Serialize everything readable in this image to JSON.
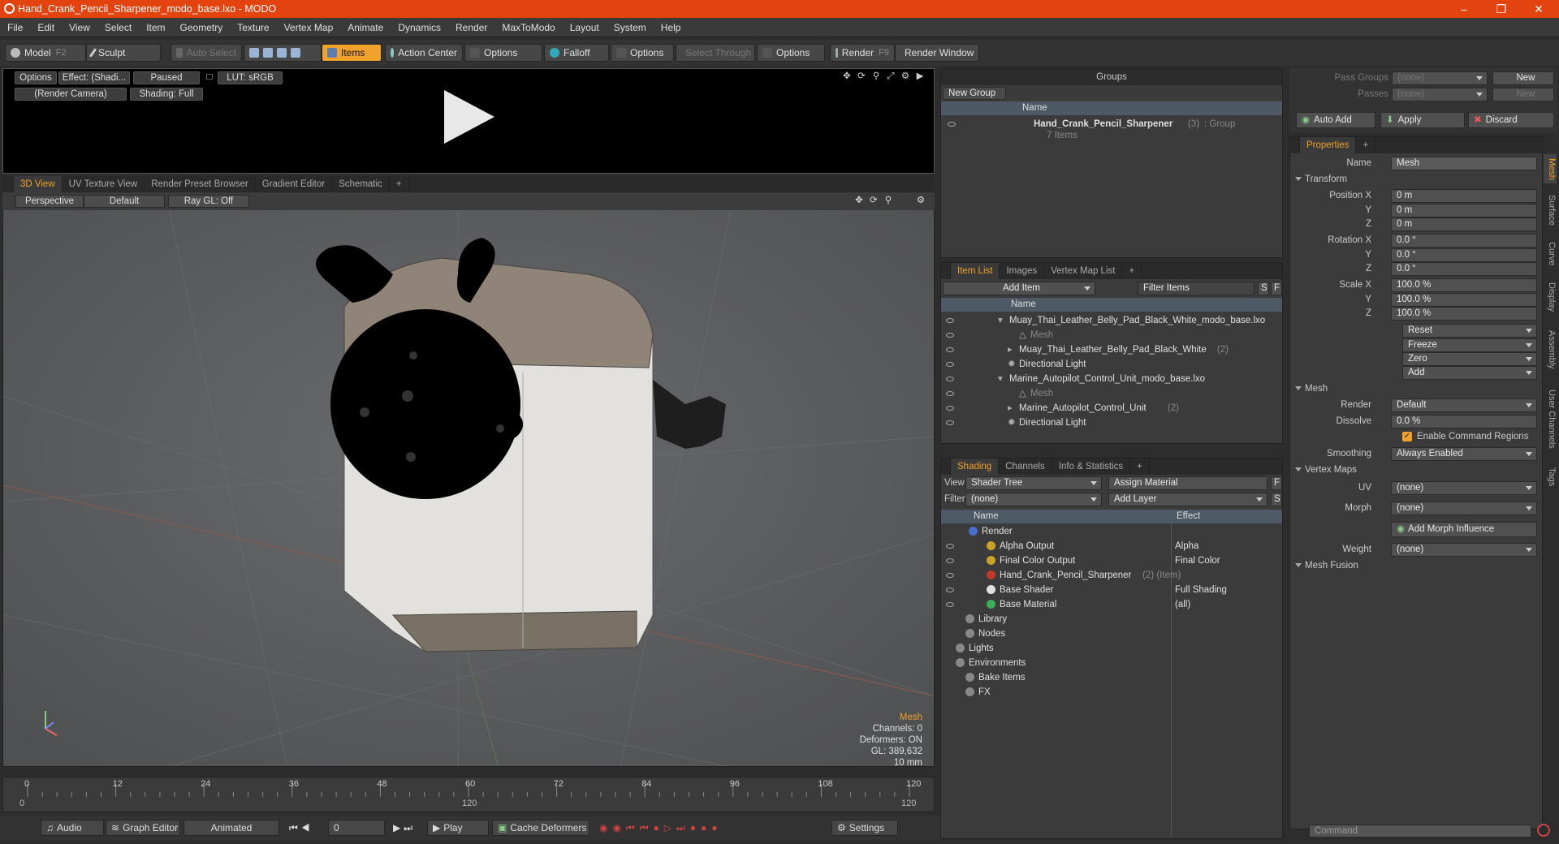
{
  "window": {
    "title": "Hand_Crank_Pencil_Sharpener_modo_base.lxo - MODO"
  },
  "menu": [
    "File",
    "Edit",
    "View",
    "Select",
    "Item",
    "Geometry",
    "Texture",
    "Vertex Map",
    "Animate",
    "Dynamics",
    "Render",
    "MaxToModo",
    "Layout",
    "System",
    "Help"
  ],
  "toolbar": {
    "model": "Model",
    "model_key": "F2",
    "sculpt": "Sculpt",
    "auto_select": "Auto Select",
    "items": "Items",
    "action_center": "Action Center",
    "options1": "Options",
    "falloff": "Falloff",
    "options2": "Options",
    "select_through": "Select Through",
    "options3": "Options",
    "render": "Render",
    "render_key": "F9",
    "render_window": "Render Window"
  },
  "preview": {
    "options": "Options",
    "effect": "Effect: (Shadi...",
    "paused": "Paused",
    "lut": "LUT: sRGB",
    "camera": "(Render Camera)",
    "shading": "Shading: Full"
  },
  "viewtabs": [
    "3D View",
    "UV Texture View",
    "Render Preset Browser",
    "Gradient Editor",
    "Schematic",
    "+"
  ],
  "viewport": {
    "perspective": "Perspective",
    "default": "Default",
    "raygl": "Ray GL: Off",
    "info": {
      "mode": "Mesh",
      "channels": "Channels: 0",
      "deformers": "Deformers: ON",
      "gl": "GL: 389,632",
      "scale": "10 mm"
    }
  },
  "timeline": {
    "ticks": [
      "0",
      "12",
      "24",
      "36",
      "48",
      "60",
      "72",
      "84",
      "96",
      "108",
      "120"
    ],
    "start": "0",
    "mid": "120",
    "end": "120"
  },
  "bottombar": {
    "audio": "Audio",
    "graph_editor": "Graph Editor",
    "animated": "Animated",
    "frame": "0",
    "play": "Play",
    "cache": "Cache Deformers",
    "settings": "Settings"
  },
  "groups": {
    "title": "Groups",
    "new_group": "New Group",
    "col_name": "Name",
    "item_name": "Hand_Crank_Pencil_Sharpener",
    "item_count": "(3)",
    "item_type": ": Group",
    "item_sub": "7 Items"
  },
  "itemlist": {
    "tabs": [
      "Item List",
      "Images",
      "Vertex Map List",
      "+"
    ],
    "add_item": "Add Item",
    "filter": "Filter Items",
    "s": "S",
    "f": "F",
    "col_name": "Name",
    "rows": [
      {
        "label": "Muay_Thai_Leather_Belly_Pad_Black_White_modo_base.lxo",
        "count": ""
      },
      {
        "label": "Mesh",
        "count": ""
      },
      {
        "label": "Muay_Thai_Leather_Belly_Pad_Black_White",
        "count": "(2)"
      },
      {
        "label": "Directional Light",
        "count": ""
      },
      {
        "label": "Marine_Autopilot_Control_Unit_modo_base.lxo",
        "count": ""
      },
      {
        "label": "Mesh",
        "count": ""
      },
      {
        "label": "Marine_Autopilot_Control_Unit",
        "count": "(2)"
      },
      {
        "label": "Directional Light",
        "count": ""
      }
    ]
  },
  "shading": {
    "tabs": [
      "Shading",
      "Channels",
      "Info & Statistics",
      "+"
    ],
    "view_label": "View",
    "view_value": "Shader Tree",
    "assign": "Assign Material",
    "f": "F",
    "filter_label": "Filter",
    "filter_value": "(none)",
    "add_layer": "Add Layer",
    "s": "S",
    "col_name": "Name",
    "col_effect": "Effect",
    "rows": [
      {
        "name": "Render",
        "effect": "",
        "extra": ""
      },
      {
        "name": "Alpha Output",
        "effect": "Alpha",
        "extra": ""
      },
      {
        "name": "Final Color Output",
        "effect": "Final Color",
        "extra": ""
      },
      {
        "name": "Hand_Crank_Pencil_Sharpener",
        "effect": "",
        "extra": "(2) (Item)"
      },
      {
        "name": "Base Shader",
        "effect": "Full Shading",
        "extra": ""
      },
      {
        "name": "Base Material",
        "effect": "(all)",
        "extra": ""
      },
      {
        "name": "Library",
        "effect": "",
        "extra": ""
      },
      {
        "name": "Nodes",
        "effect": "",
        "extra": ""
      },
      {
        "name": "Lights",
        "effect": "",
        "extra": ""
      },
      {
        "name": "Environments",
        "effect": "",
        "extra": ""
      },
      {
        "name": "Bake Items",
        "effect": "",
        "extra": ""
      },
      {
        "name": "FX",
        "effect": "",
        "extra": ""
      }
    ]
  },
  "passes": {
    "pass_groups": "Pass Groups",
    "passes": "Passes",
    "none": "(none)",
    "new": "New",
    "auto_add": "Auto Add",
    "apply": "Apply",
    "discard": "Discard"
  },
  "properties": {
    "tab": "Properties",
    "plus": "+",
    "name_label": "Name",
    "name_value": "Mesh",
    "transform": "Transform",
    "position_x": "Position X",
    "y": "Y",
    "z": "Z",
    "rotation_x": "Rotation X",
    "scale_x": "Scale X",
    "pos": [
      "0 m",
      "0 m",
      "0 m"
    ],
    "rot": [
      "0.0 °",
      "0.0 °",
      "0.0 °"
    ],
    "scale": [
      "100.0 %",
      "100.0 %",
      "100.0 %"
    ],
    "reset": "Reset",
    "freeze": "Freeze",
    "zero": "Zero",
    "add": "Add",
    "mesh": "Mesh",
    "render_label": "Render",
    "render_value": "Default",
    "dissolve_label": "Dissolve",
    "dissolve_value": "0.0 %",
    "enable_cmd": "Enable Command Regions",
    "smoothing_label": "Smoothing",
    "smoothing_value": "Always Enabled",
    "vertex_maps": "Vertex Maps",
    "uv_label": "UV",
    "uv_value": "(none)",
    "morph_label": "Morph",
    "morph_value": "(none)",
    "add_morph": "Add Morph Influence",
    "weight_label": "Weight",
    "weight_value": "(none)",
    "mesh_fusion": "Mesh Fusion",
    "side_tabs": [
      "Mesh",
      "Surface",
      "Curve",
      "Display",
      "Assembly",
      "User Channels",
      "Tags"
    ]
  },
  "command": {
    "placeholder": "Command"
  },
  "colors": {
    "accent": "#f0a22b",
    "titlebar": "#e2430f"
  }
}
